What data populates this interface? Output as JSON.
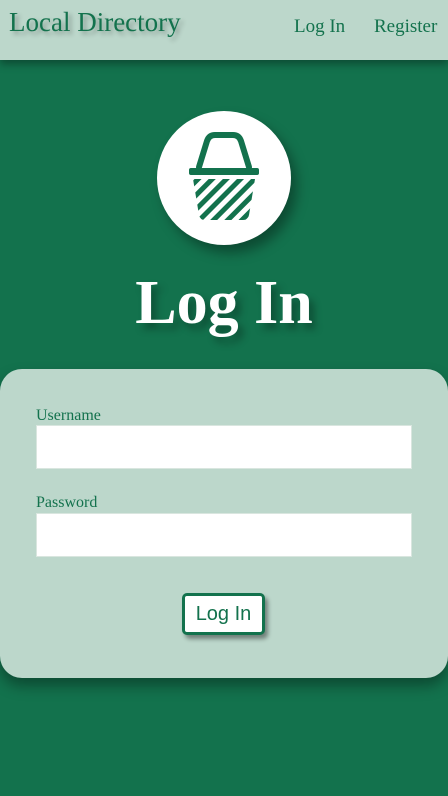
{
  "navbar": {
    "brand": "Local Directory",
    "links": [
      {
        "label": "Log In"
      },
      {
        "label": "Register"
      }
    ]
  },
  "logo": {
    "icon": "shopping-basket-icon",
    "color": "#13724d"
  },
  "page": {
    "title": "Log In"
  },
  "form": {
    "username": {
      "label": "Username",
      "value": "",
      "placeholder": ""
    },
    "password": {
      "label": "Password",
      "value": "",
      "placeholder": ""
    },
    "submit_label": "Log In"
  },
  "colors": {
    "primary": "#13724d",
    "panel": "#bcd7cb",
    "white": "#ffffff"
  }
}
